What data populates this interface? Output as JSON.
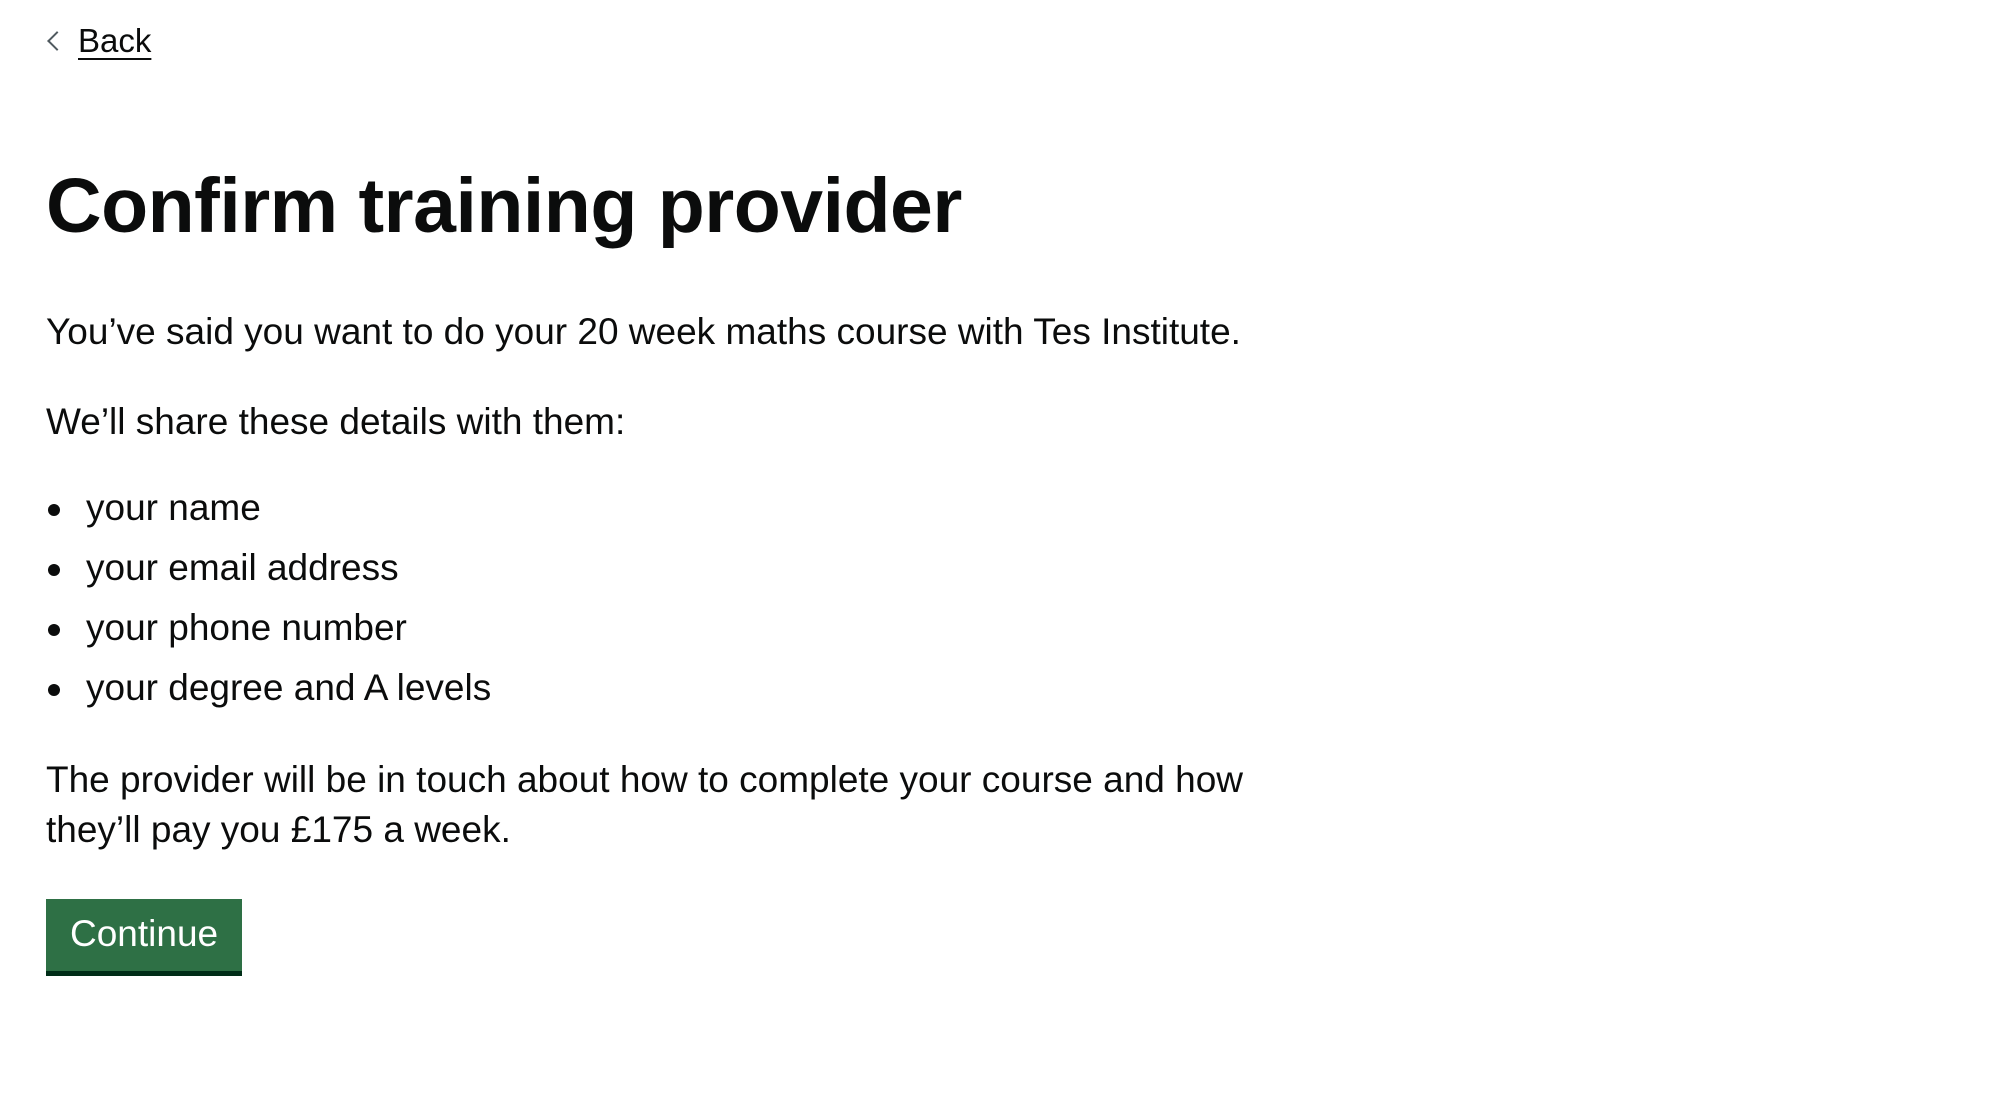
{
  "nav": {
    "back_label": "Back"
  },
  "page": {
    "title": "Confirm training provider",
    "intro": "You’ve said you want to do your 20 week maths course with Tes Institute.",
    "share_heading": "We’ll share these details with them:",
    "details": [
      "your name",
      "your email address",
      "your phone number",
      "your degree and A levels"
    ],
    "outro": "The provider will be in touch about how to complete your course and how they’ll pay you £175 a week."
  },
  "actions": {
    "continue_label": "Continue"
  },
  "colors": {
    "button_bg": "#2e7045",
    "button_shadow": "#002d18",
    "text": "#0b0c0c"
  }
}
